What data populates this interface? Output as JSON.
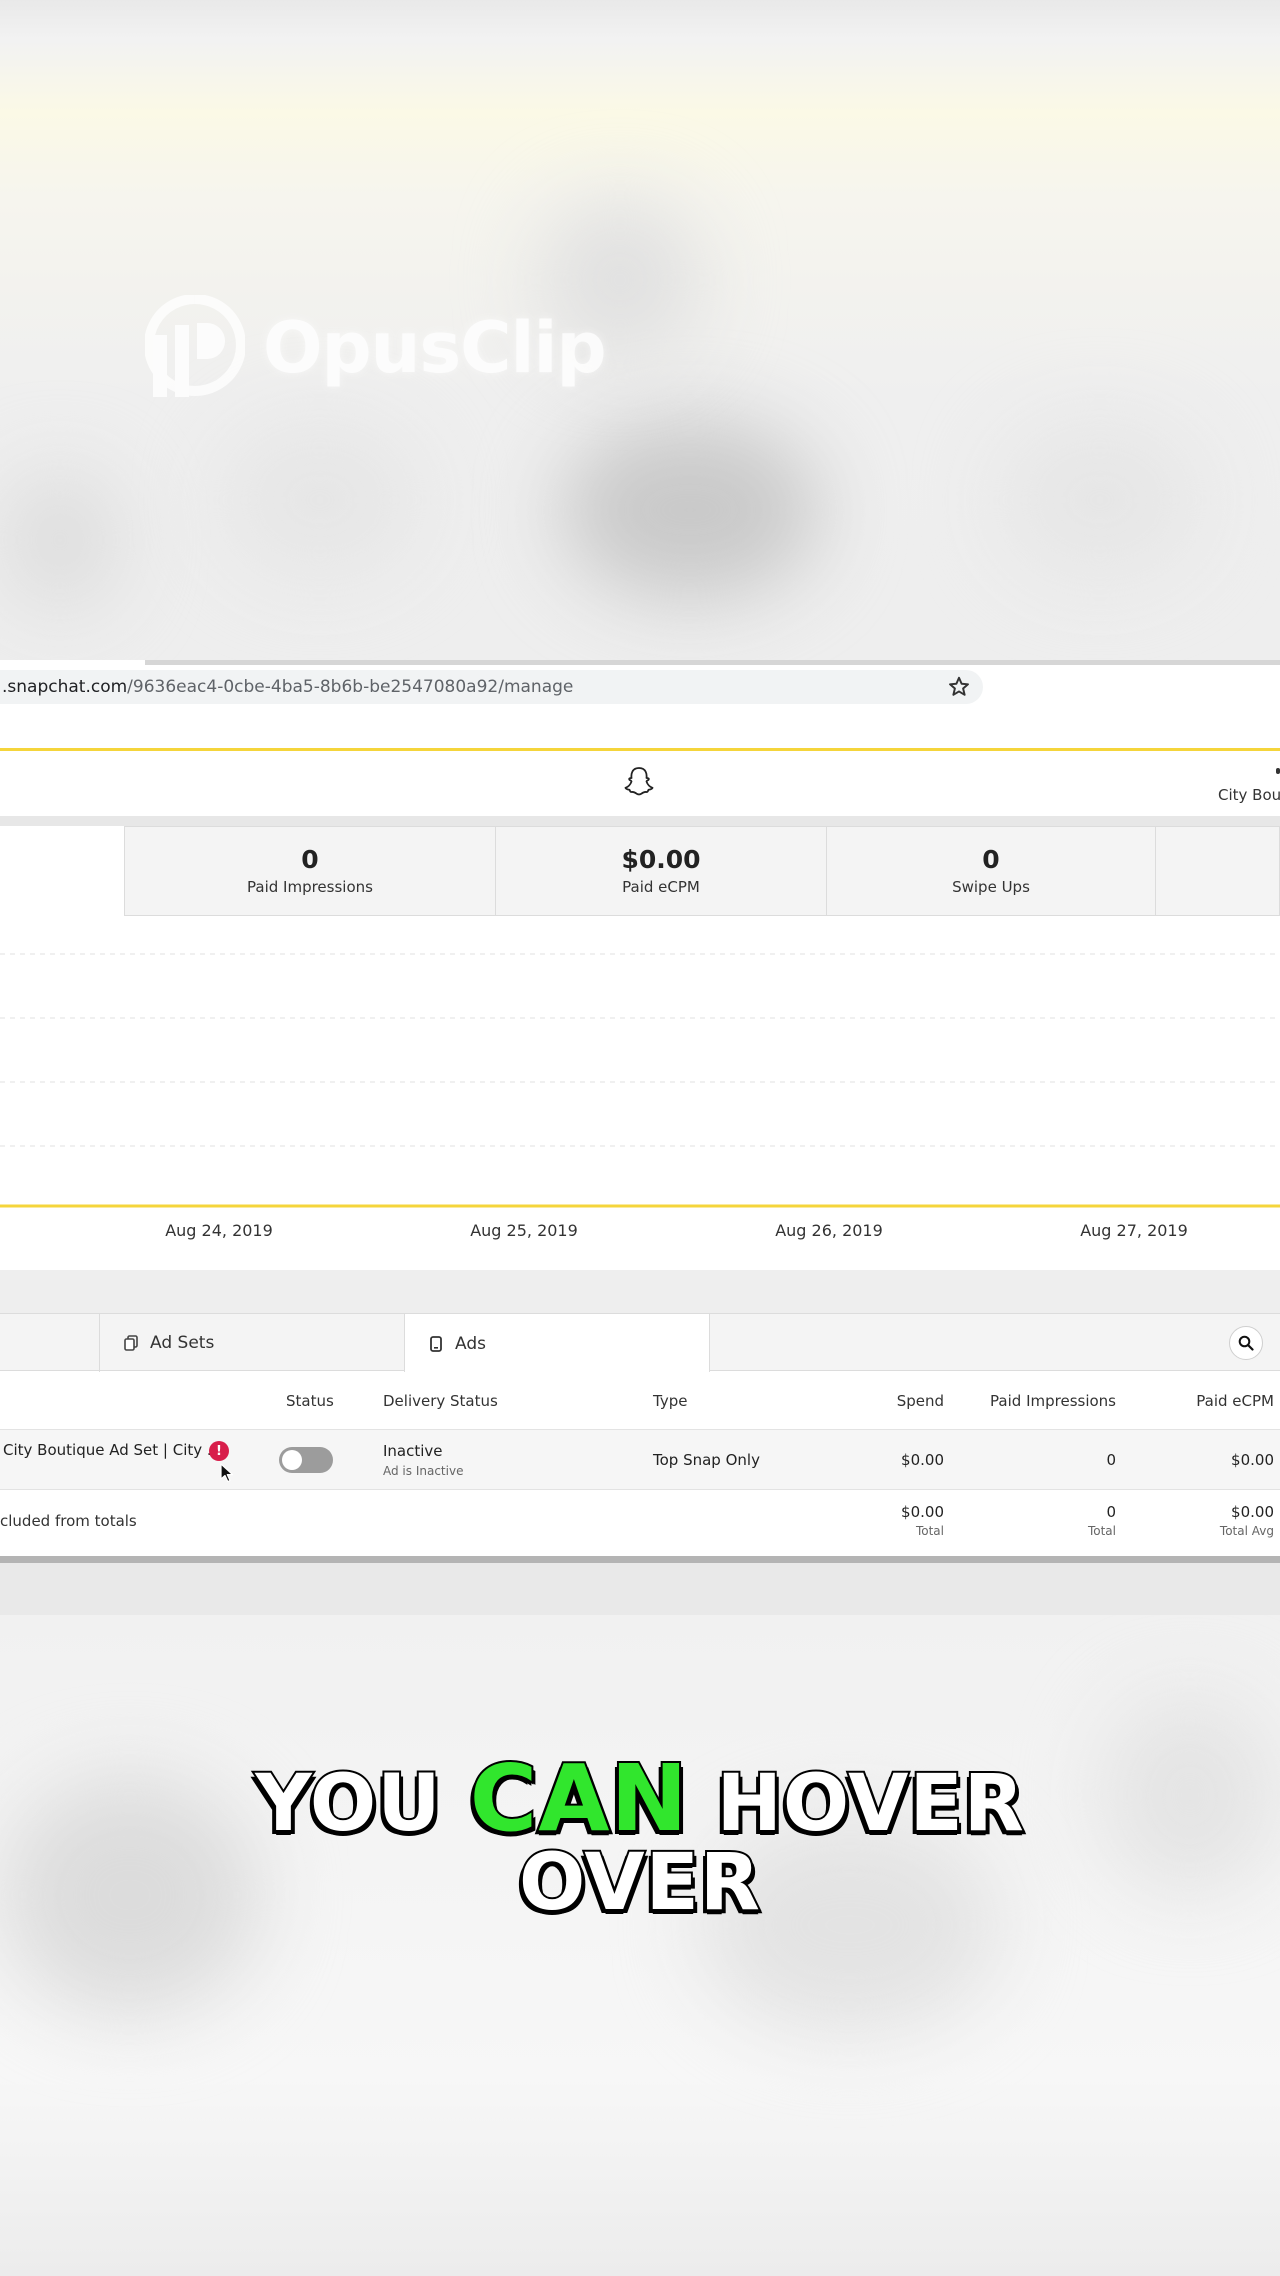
{
  "watermark": {
    "brand": "OpusClip"
  },
  "browser": {
    "url_host": "snapchat.com",
    "url_path": "/9636eac4-0cbe-4ba5-8b6b-be2547080a92/manage",
    "url_prefix": "."
  },
  "header": {
    "account_name": "City Bout"
  },
  "metrics": [
    {
      "value": "0",
      "label": "Paid Impressions"
    },
    {
      "value": "$0.00",
      "label": "Paid eCPM"
    },
    {
      "value": "0",
      "label": "Swipe Ups"
    }
  ],
  "chart_data": {
    "type": "line",
    "x": [
      "Aug 24, 2019",
      "Aug 25, 2019",
      "Aug 26, 2019",
      "Aug 27, 2019"
    ],
    "series": [
      {
        "values": [
          0,
          0,
          0,
          0
        ]
      }
    ],
    "grid": true,
    "color": "#f5d53b"
  },
  "tabs": [
    {
      "label": "Ad Sets"
    },
    {
      "label": "Ads"
    }
  ],
  "table": {
    "headers": {
      "status": "Status",
      "delivery_status": "Delivery Status",
      "type": "Type",
      "spend": "Spend",
      "paid_impressions": "Paid Impressions",
      "paid_ecpm": "Paid eCPM"
    },
    "rows": [
      {
        "name": "City Boutique Ad Set | City ...",
        "alert": "!",
        "status_on": false,
        "delivery_status": "Inactive",
        "delivery_sub": "Ad is Inactive",
        "type": "Top Snap Only",
        "spend": "$0.00",
        "paid_impressions": "0",
        "paid_ecpm": "$0.00"
      }
    ],
    "totals": {
      "note": "cluded from totals",
      "spend": "$0.00",
      "spend_label": "Total",
      "paid_impressions": "0",
      "paid_impressions_label": "Total",
      "paid_ecpm": "$0.00",
      "paid_ecpm_label": "Total Avg"
    }
  },
  "caption": {
    "line1_a": "YOU",
    "line1_b": "CAN",
    "line1_c": "HOVER",
    "line2": "OVER"
  },
  "colors": {
    "snap_yellow": "#f5d53b",
    "alert_red": "#d81e4b",
    "caption_highlight": "#31e62d"
  }
}
